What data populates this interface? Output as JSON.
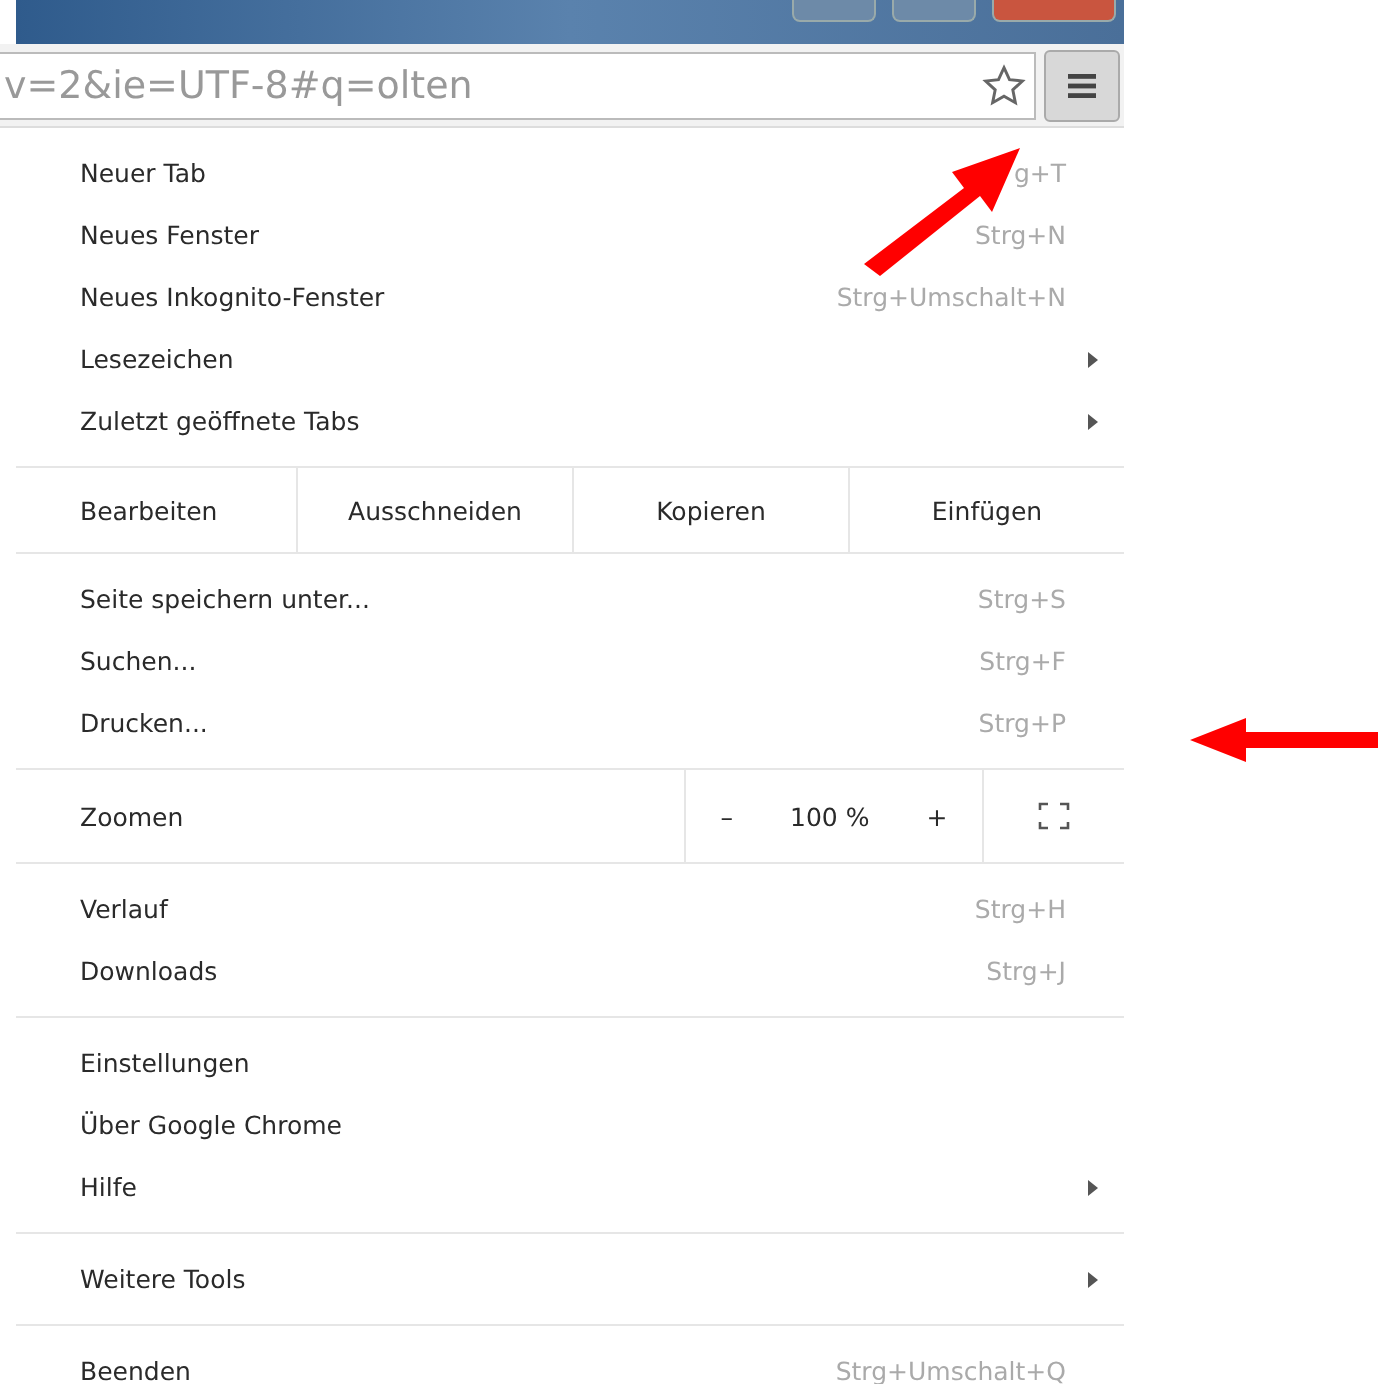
{
  "address_bar": {
    "value": "v=2&ie=UTF-8#q=olten",
    "bookmarked": false
  },
  "menu_sections": [
    {
      "kind": "items",
      "items": [
        {
          "label": "Neuer Tab",
          "shortcut": "g+T",
          "submenu": false
        },
        {
          "label": "Neues Fenster",
          "shortcut": "Strg+N",
          "submenu": false
        },
        {
          "label": "Neues Inkognito-Fenster",
          "shortcut": "Strg+Umschalt+N",
          "submenu": false
        },
        {
          "label": "Lesezeichen",
          "submenu": true
        },
        {
          "label": "Zuletzt geöffnete Tabs",
          "submenu": true
        }
      ]
    },
    {
      "kind": "edit",
      "label": "Bearbeiten",
      "buttons": [
        "Ausschneiden",
        "Kopieren",
        "Einfügen"
      ]
    },
    {
      "kind": "items",
      "items": [
        {
          "label": "Seite speichern unter...",
          "shortcut": "Strg+S",
          "submenu": false
        },
        {
          "label": "Suchen...",
          "shortcut": "Strg+F",
          "submenu": false
        },
        {
          "label": "Drucken...",
          "shortcut": "Strg+P",
          "submenu": false
        }
      ]
    },
    {
      "kind": "zoom",
      "label": "Zoomen",
      "minus": "–",
      "value": "100 %",
      "plus": "+"
    },
    {
      "kind": "items",
      "items": [
        {
          "label": "Verlauf",
          "shortcut": "Strg+H",
          "submenu": false
        },
        {
          "label": "Downloads",
          "shortcut": "Strg+J",
          "submenu": false
        }
      ]
    },
    {
      "kind": "items",
      "items": [
        {
          "label": "Einstellungen",
          "submenu": false
        },
        {
          "label": "Über Google Chrome",
          "submenu": false
        },
        {
          "label": "Hilfe",
          "submenu": true
        }
      ]
    },
    {
      "kind": "items",
      "items": [
        {
          "label": "Weitere Tools",
          "submenu": true
        }
      ]
    },
    {
      "kind": "items",
      "items": [
        {
          "label": "Beenden",
          "shortcut": "Strg+Umschalt+Q",
          "submenu": false
        }
      ]
    }
  ]
}
